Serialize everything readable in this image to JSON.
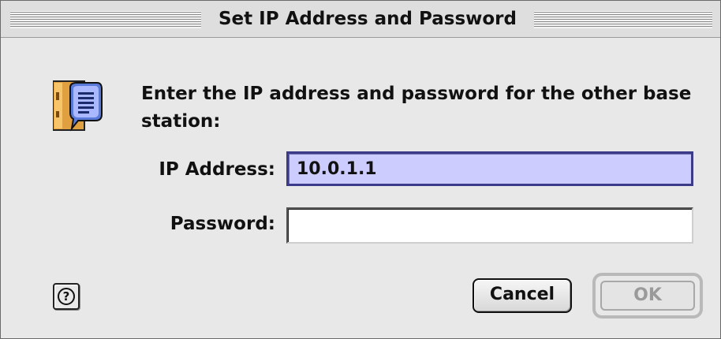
{
  "window": {
    "title": "Set IP Address and Password"
  },
  "dialog": {
    "icon": "base-station-info-icon",
    "prompt": "Enter the IP address and password for the other base station:",
    "fields": {
      "ip_label": "IP Address:",
      "ip_value": "10.0.1.1",
      "password_label": "Password:",
      "password_value": ""
    },
    "help_icon": "question-mark-icon",
    "help_glyph": "?",
    "buttons": {
      "cancel": "Cancel",
      "ok": "OK"
    }
  },
  "colors": {
    "selection_fill": "#ccccff",
    "dialog_background": "#e8e8e8",
    "disabled_text": "#9a9a9a"
  }
}
